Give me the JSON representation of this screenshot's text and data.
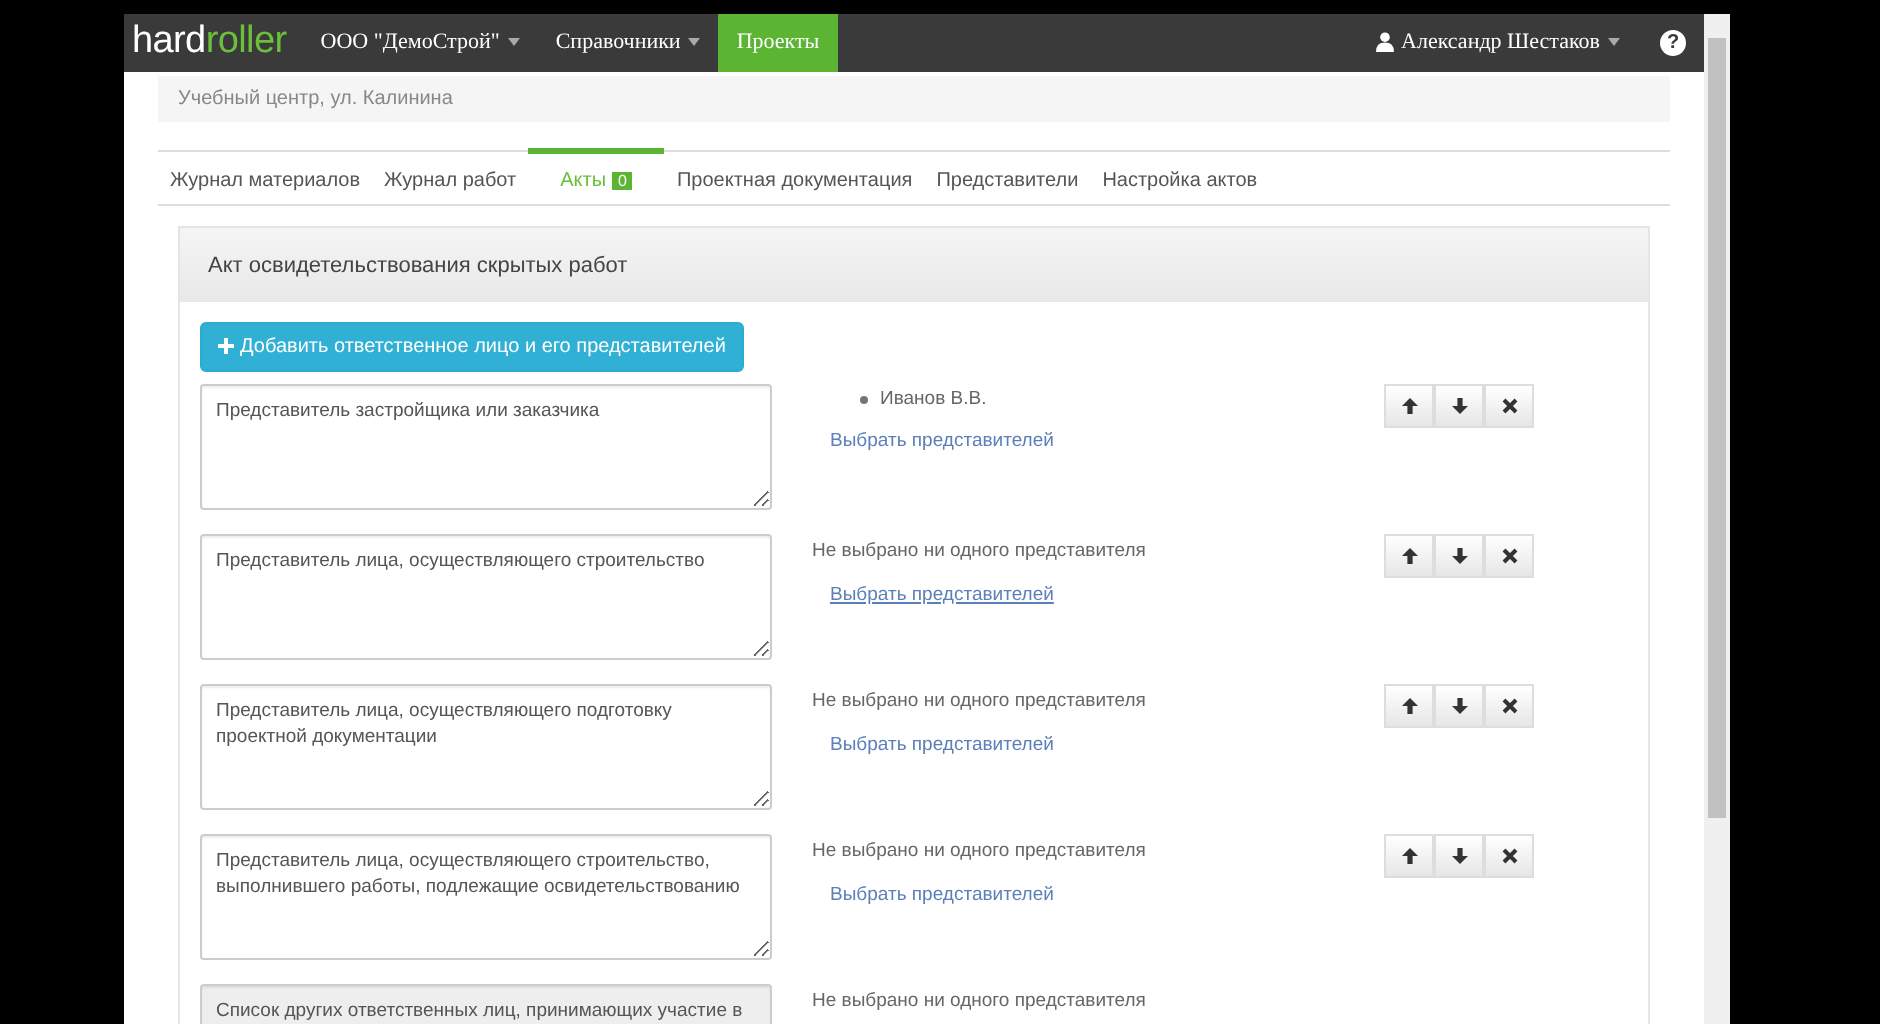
{
  "navbar": {
    "brand_dark": "hard",
    "brand_green": "roller",
    "menus": [
      {
        "label": "ООО \"ДемоСтрой\"",
        "dropdown": true,
        "selected": false
      },
      {
        "label": "Справочники",
        "dropdown": true,
        "selected": false
      },
      {
        "label": "Проекты",
        "dropdown": false,
        "selected": true
      }
    ],
    "user": "Александр Шестаков",
    "help": "?"
  },
  "breadcrumb": "Учебный центр, ул. Калинина",
  "tabs": [
    {
      "label": "Журнал материалов",
      "selected": false
    },
    {
      "label": "Журнал работ",
      "selected": false
    },
    {
      "label": "Акты",
      "selected": true,
      "badge": "0"
    },
    {
      "label": "Проектная документация",
      "selected": false
    },
    {
      "label": "Представители",
      "selected": false
    },
    {
      "label": "Настройка актов",
      "selected": false
    }
  ],
  "panel": {
    "title": "Акт освидетельствования скрытых работ",
    "add_button": "Добавить ответственное лицо и его представителей",
    "rows": [
      {
        "text": "Представитель застройщика или заказчика",
        "disabled": false,
        "representatives": [
          "Иванов В.В."
        ],
        "link": "Выбрать представителей",
        "buttons": true
      },
      {
        "text": "Представитель лица, осуществляющего строительство",
        "disabled": false,
        "empty_note": "Не выбрано ни одного представителя",
        "link": "Выбрать представителей",
        "buttons": true
      },
      {
        "text": "Представитель лица, осуществляющего подготовку проектной документации",
        "disabled": false,
        "empty_note": "Не выбрано ни одного представителя",
        "link": "Выбрать представителей",
        "buttons": true
      },
      {
        "text": "Представитель лица, осуществляющего строительство, выполнившего работы, подлежащие освидетельствованию",
        "disabled": false,
        "empty_note": "Не выбрано ни одного представителя",
        "link": "Выбрать представителей",
        "buttons": true
      },
      {
        "text": "Список других ответственных лиц, принимающих участие в",
        "disabled": true,
        "empty_note": "Не выбрано ни одного представителя",
        "buttons": false
      }
    ]
  }
}
